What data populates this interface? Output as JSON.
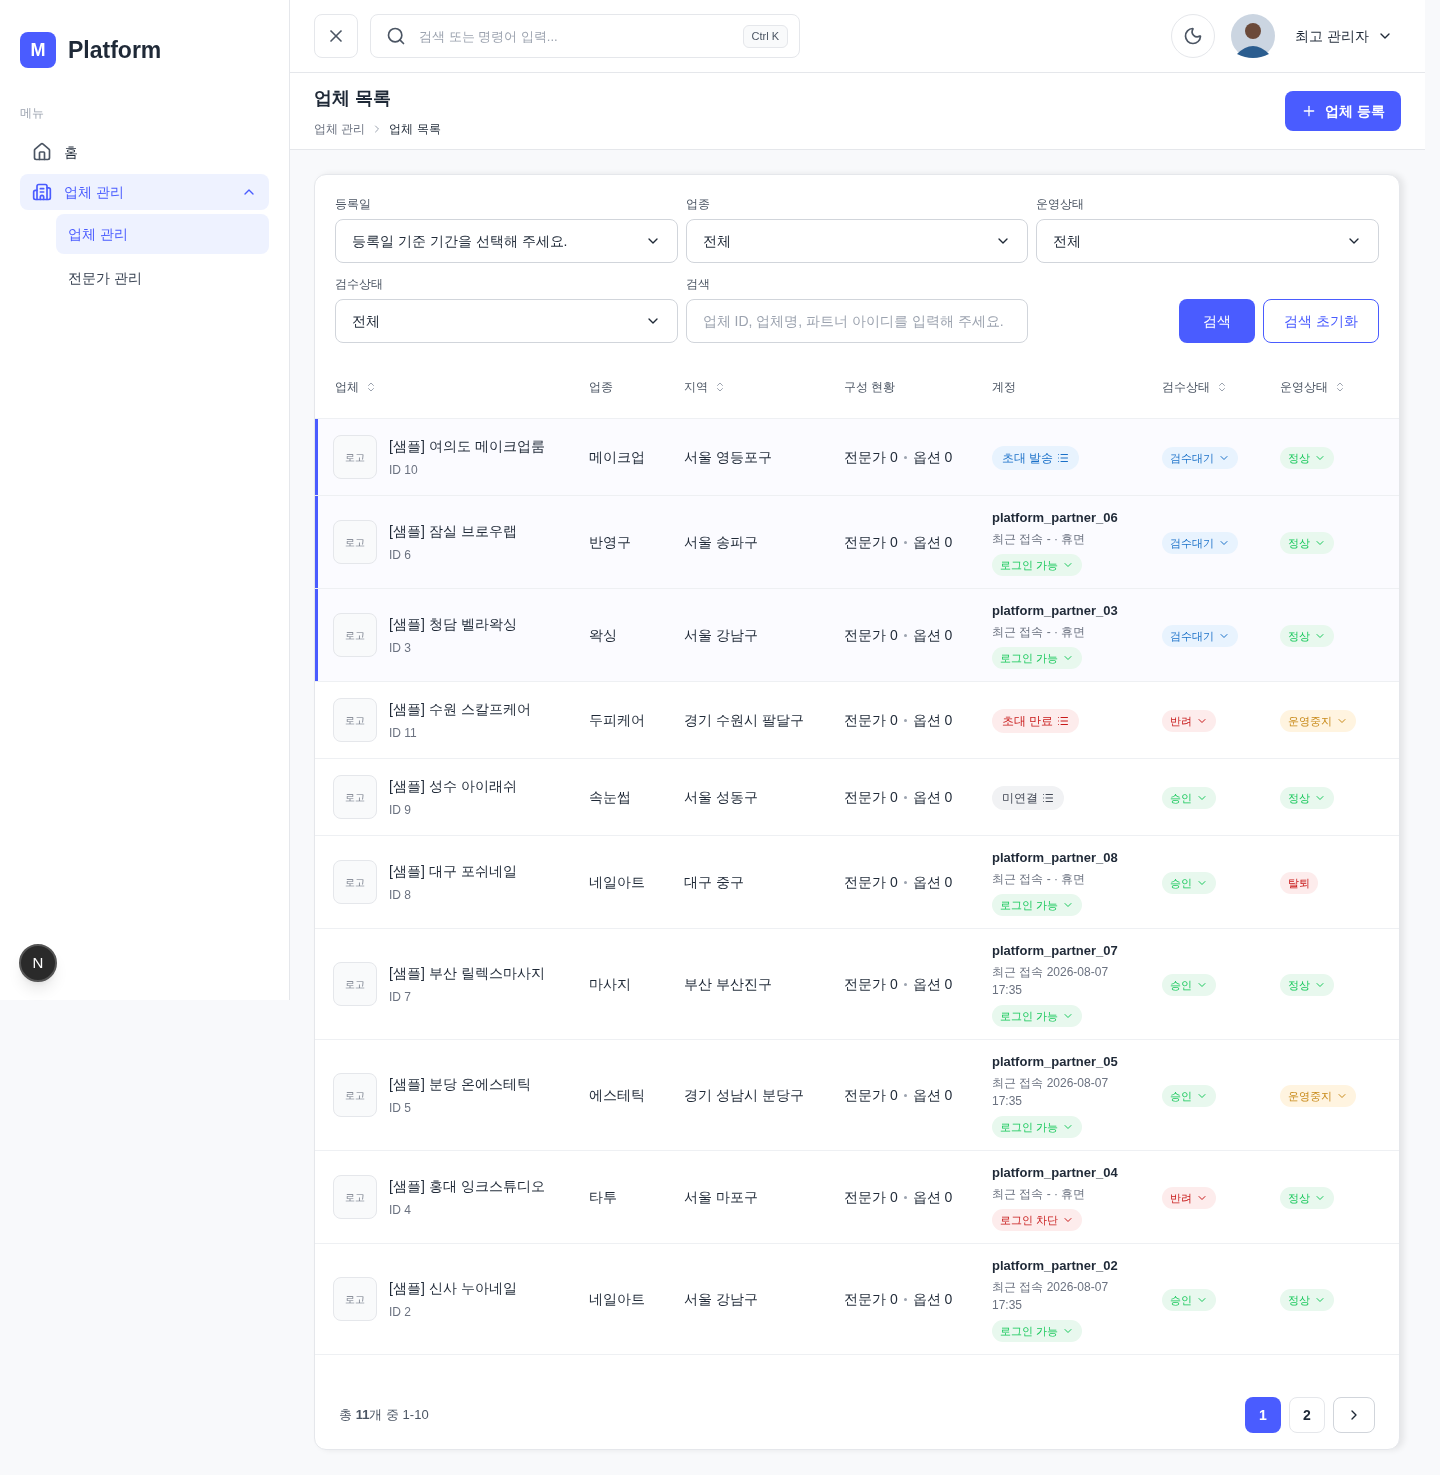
{
  "sidebar": {
    "logo_letter": "M",
    "brand": "Platform",
    "section": "메뉴",
    "items": [
      {
        "label": "홈",
        "selected": false
      },
      {
        "label": "업체 관리",
        "selected": true,
        "expanded": true,
        "children": [
          {
            "label": "업체 관리",
            "selected": true
          },
          {
            "label": "전문가 관리",
            "selected": false
          }
        ]
      }
    ],
    "dev_badge": "N"
  },
  "topbar": {
    "search_placeholder": "검색 또는 명령어 입력...",
    "shortcut": "Ctrl K",
    "user": "최고 관리자"
  },
  "page": {
    "title": "업체 목록",
    "breadcrumb": [
      "업체 관리",
      "업체 목록"
    ],
    "primary_action": "업체 등록"
  },
  "filters": [
    {
      "label": "등록일",
      "kind": "select",
      "value": "등록일 기준 기간을 선택해 주세요."
    },
    {
      "label": "업종",
      "kind": "select",
      "value": "전체"
    },
    {
      "label": "운영상태",
      "kind": "select",
      "value": "전체"
    },
    {
      "label": "검수상태",
      "kind": "select",
      "value": "전체"
    },
    {
      "label": "검색",
      "kind": "input",
      "placeholder": "업체 ID, 업체명, 파트너 아이디를 입력해 주세요."
    }
  ],
  "filter_buttons": {
    "search": "검색",
    "reset": "검색 초기화"
  },
  "table": {
    "columns": [
      {
        "label": "업체",
        "sortable": true
      },
      {
        "label": "업종",
        "sortable": false
      },
      {
        "label": "지역",
        "sortable": true
      },
      {
        "label": "구성 현황",
        "sortable": false
      },
      {
        "label": "계정",
        "sortable": false
      },
      {
        "label": "검수상태",
        "sortable": true
      },
      {
        "label": "운영상태",
        "sortable": true
      }
    ],
    "rows": [
      {
        "selected": true,
        "logo": "로고",
        "name": "[샘플] 여의도 메이크업룸",
        "id": "ID 10",
        "category": "메이크업",
        "region": "서울 영등포구",
        "experts": "전문가 0",
        "options": "옵션 0",
        "account": {
          "kind": "invite",
          "label": "초대 발송",
          "color": "#e8f3fe"
        },
        "review": {
          "label": "검수대기",
          "color": "#e8f3fe",
          "caret": true
        },
        "ops": {
          "label": "정상",
          "color": "#e8f8ee",
          "caret": true
        }
      },
      {
        "selected": true,
        "logo": "로고",
        "name": "[샘플] 잠실 브로우랩",
        "id": "ID 6",
        "category": "반영구",
        "region": "서울 송파구",
        "experts": "전문가 0",
        "options": "옵션 0",
        "account": {
          "kind": "account",
          "username": "platform_partner_06",
          "last_login": "최근 접속 - · 휴면",
          "login": {
            "label": "로그인 가능",
            "color": "#e8f8ee"
          }
        },
        "review": {
          "label": "검수대기",
          "color": "#e8f3fe",
          "caret": true
        },
        "ops": {
          "label": "정상",
          "color": "#e8f8ee",
          "caret": true
        }
      },
      {
        "selected": true,
        "logo": "로고",
        "name": "[샘플] 청담 벨라왁싱",
        "id": "ID 3",
        "category": "왁싱",
        "region": "서울 강남구",
        "experts": "전문가 0",
        "options": "옵션 0",
        "account": {
          "kind": "account",
          "username": "platform_partner_03",
          "last_login": "최근 접속 - · 휴면",
          "login": {
            "label": "로그인 가능",
            "color": "#e8f8ee"
          }
        },
        "review": {
          "label": "검수대기",
          "color": "#e8f3fe",
          "caret": true
        },
        "ops": {
          "label": "정상",
          "color": "#e8f8ee",
          "caret": true
        }
      },
      {
        "selected": false,
        "logo": "로고",
        "name": "[샘플] 수원 스칼프케어",
        "id": "ID 11",
        "category": "두피케어",
        "region": "경기 수원시 팔달구",
        "experts": "전문가 0",
        "options": "옵션 0",
        "account": {
          "kind": "invite",
          "label": "초대 만료",
          "color": "#fdecec"
        },
        "review": {
          "label": "반려",
          "color": "#fdecec",
          "caret": true
        },
        "ops": {
          "label": "운영중지",
          "color": "#fff4e0",
          "caret": true
        }
      },
      {
        "selected": false,
        "logo": "로고",
        "name": "[샘플] 성수 아이래쉬",
        "id": "ID 9",
        "category": "속눈썹",
        "region": "서울 성동구",
        "experts": "전문가 0",
        "options": "옵션 0",
        "account": {
          "kind": "invite",
          "label": "미연결",
          "color": "#f1f2f4"
        },
        "review": {
          "label": "승인",
          "color": "#e8f8ee",
          "caret": true
        },
        "ops": {
          "label": "정상",
          "color": "#e8f8ee",
          "caret": true
        }
      },
      {
        "selected": false,
        "logo": "로고",
        "name": "[샘플] 대구 포쉬네일",
        "id": "ID 8",
        "category": "네일아트",
        "region": "대구 중구",
        "experts": "전문가 0",
        "options": "옵션 0",
        "account": {
          "kind": "account",
          "username": "platform_partner_08",
          "last_login": "최근 접속 - · 휴면",
          "login": {
            "label": "로그인 가능",
            "color": "#e8f8ee"
          }
        },
        "review": {
          "label": "승인",
          "color": "#e8f8ee",
          "caret": true
        },
        "ops": {
          "label": "탈퇴",
          "color": "#fdecec",
          "caret": false
        }
      },
      {
        "selected": false,
        "logo": "로고",
        "name": "[샘플] 부산 릴렉스마사지",
        "id": "ID 7",
        "category": "마사지",
        "region": "부산 부산진구",
        "experts": "전문가 0",
        "options": "옵션 0",
        "account": {
          "kind": "account",
          "username": "platform_partner_07",
          "last_login": "최근 접속 2026-08-07 17:35",
          "login": {
            "label": "로그인 가능",
            "color": "#e8f8ee"
          }
        },
        "review": {
          "label": "승인",
          "color": "#e8f8ee",
          "caret": true
        },
        "ops": {
          "label": "정상",
          "color": "#e8f8ee",
          "caret": true
        }
      },
      {
        "selected": false,
        "logo": "로고",
        "name": "[샘플] 분당 온에스테틱",
        "id": "ID 5",
        "category": "에스테틱",
        "region": "경기 성남시 분당구",
        "experts": "전문가 0",
        "options": "옵션 0",
        "account": {
          "kind": "account",
          "username": "platform_partner_05",
          "last_login": "최근 접속 2026-08-07 17:35",
          "login": {
            "label": "로그인 가능",
            "color": "#e8f8ee"
          }
        },
        "review": {
          "label": "승인",
          "color": "#e8f8ee",
          "caret": true
        },
        "ops": {
          "label": "운영중지",
          "color": "#fff4e0",
          "caret": true
        }
      },
      {
        "selected": false,
        "logo": "로고",
        "name": "[샘플] 홍대 잉크스튜디오",
        "id": "ID 4",
        "category": "타투",
        "region": "서울 마포구",
        "experts": "전문가 0",
        "options": "옵션 0",
        "account": {
          "kind": "account",
          "username": "platform_partner_04",
          "last_login": "최근 접속 - · 휴면",
          "login": {
            "label": "로그인 차단",
            "color": "#fdecec"
          }
        },
        "review": {
          "label": "반려",
          "color": "#fdecec",
          "caret": true
        },
        "ops": {
          "label": "정상",
          "color": "#e8f8ee",
          "caret": true
        }
      },
      {
        "selected": false,
        "logo": "로고",
        "name": "[샘플] 신사 누아네일",
        "id": "ID 2",
        "category": "네일아트",
        "region": "서울 강남구",
        "experts": "전문가 0",
        "options": "옵션 0",
        "account": {
          "kind": "account",
          "username": "platform_partner_02",
          "last_login": "최근 접속 2026-08-07 17:35",
          "login": {
            "label": "로그인 가능",
            "color": "#e8f8ee"
          }
        },
        "review": {
          "label": "승인",
          "color": "#e8f8ee",
          "caret": true
        },
        "ops": {
          "label": "정상",
          "color": "#e8f8ee",
          "caret": true
        }
      }
    ]
  },
  "pagination": {
    "summary": "총 **11**개 중 1-10",
    "pages": [
      {
        "label": "1",
        "selected": true
      },
      {
        "label": "2",
        "selected": false
      }
    ]
  }
}
